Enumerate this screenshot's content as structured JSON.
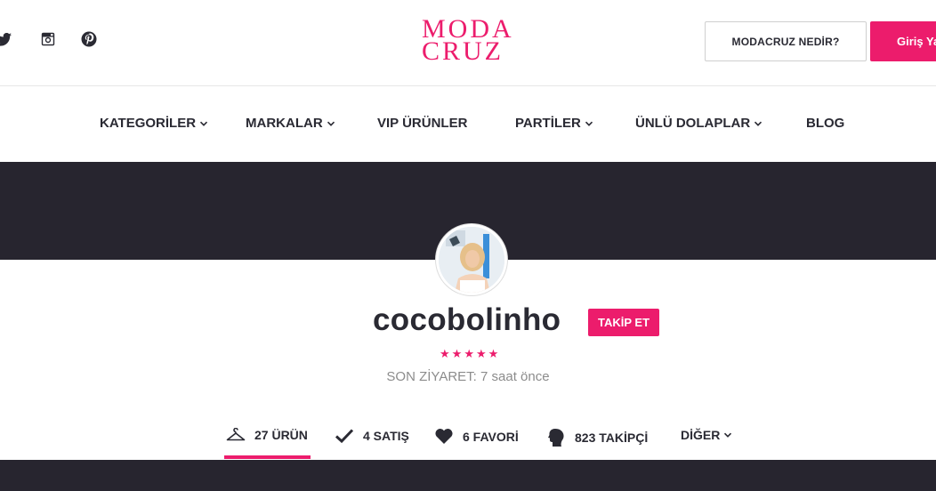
{
  "header": {
    "logo_line1": "MODA",
    "logo_line2": "CRUZ",
    "what_is_label": "MODACRUZ NEDİR?",
    "login_label": "Giriş Yap",
    "social": [
      "twitter-icon",
      "instagram-icon",
      "pinterest-icon"
    ]
  },
  "nav": {
    "items": [
      {
        "label": "KATEGORİLER",
        "has_dropdown": true
      },
      {
        "label": "MARKALAR",
        "has_dropdown": true
      },
      {
        "label": "VIP ÜRÜNLER",
        "has_dropdown": false
      },
      {
        "label": "PARTİLER",
        "has_dropdown": true
      },
      {
        "label": "ÜNLÜ DOLAPLAR",
        "has_dropdown": true
      },
      {
        "label": "BLOG",
        "has_dropdown": false
      }
    ]
  },
  "profile": {
    "username": "cocobolinho",
    "follow_label": "TAKİP ET",
    "rating": 5,
    "stars": [
      "★",
      "★",
      "★",
      "★",
      "★"
    ],
    "last_visit_label": "SON ZİYARET:",
    "last_visit_value": "7 saat önce"
  },
  "tabs": {
    "items": [
      {
        "icon": "hanger-icon",
        "label": "27 ÜRÜN",
        "active": true
      },
      {
        "icon": "checkmark-icon",
        "label": "4 SATIŞ",
        "active": false
      },
      {
        "icon": "heart-icon",
        "label": "6 FAVORİ",
        "active": false
      },
      {
        "icon": "silhouette-icon",
        "label": "823 TAKİPÇİ",
        "active": false
      },
      {
        "icon": "chevron-down-icon",
        "label": "DİĞER",
        "active": false
      }
    ]
  },
  "colors": {
    "brand": "#ec1c6c",
    "dark": "#27252f",
    "text": "#2a2a33",
    "muted": "#8c8c8c"
  }
}
